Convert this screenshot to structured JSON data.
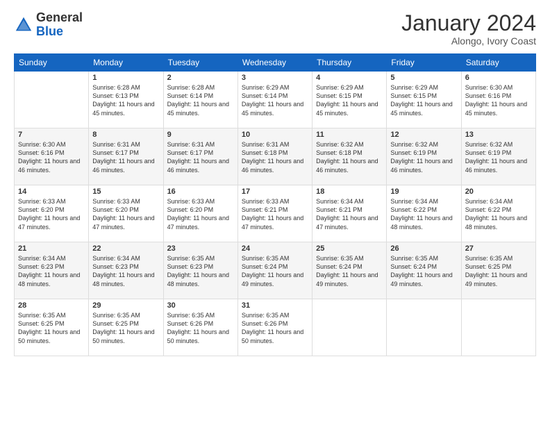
{
  "header": {
    "logo_general": "General",
    "logo_blue": "Blue",
    "month_title": "January 2024",
    "location": "Alongo, Ivory Coast"
  },
  "calendar": {
    "days_of_week": [
      "Sunday",
      "Monday",
      "Tuesday",
      "Wednesday",
      "Thursday",
      "Friday",
      "Saturday"
    ],
    "weeks": [
      [
        {
          "day": "",
          "sunrise": "",
          "sunset": "",
          "daylight": ""
        },
        {
          "day": "1",
          "sunrise": "Sunrise: 6:28 AM",
          "sunset": "Sunset: 6:13 PM",
          "daylight": "Daylight: 11 hours and 45 minutes."
        },
        {
          "day": "2",
          "sunrise": "Sunrise: 6:28 AM",
          "sunset": "Sunset: 6:14 PM",
          "daylight": "Daylight: 11 hours and 45 minutes."
        },
        {
          "day": "3",
          "sunrise": "Sunrise: 6:29 AM",
          "sunset": "Sunset: 6:14 PM",
          "daylight": "Daylight: 11 hours and 45 minutes."
        },
        {
          "day": "4",
          "sunrise": "Sunrise: 6:29 AM",
          "sunset": "Sunset: 6:15 PM",
          "daylight": "Daylight: 11 hours and 45 minutes."
        },
        {
          "day": "5",
          "sunrise": "Sunrise: 6:29 AM",
          "sunset": "Sunset: 6:15 PM",
          "daylight": "Daylight: 11 hours and 45 minutes."
        },
        {
          "day": "6",
          "sunrise": "Sunrise: 6:30 AM",
          "sunset": "Sunset: 6:16 PM",
          "daylight": "Daylight: 11 hours and 45 minutes."
        }
      ],
      [
        {
          "day": "7",
          "sunrise": "Sunrise: 6:30 AM",
          "sunset": "Sunset: 6:16 PM",
          "daylight": "Daylight: 11 hours and 46 minutes."
        },
        {
          "day": "8",
          "sunrise": "Sunrise: 6:31 AM",
          "sunset": "Sunset: 6:17 PM",
          "daylight": "Daylight: 11 hours and 46 minutes."
        },
        {
          "day": "9",
          "sunrise": "Sunrise: 6:31 AM",
          "sunset": "Sunset: 6:17 PM",
          "daylight": "Daylight: 11 hours and 46 minutes."
        },
        {
          "day": "10",
          "sunrise": "Sunrise: 6:31 AM",
          "sunset": "Sunset: 6:18 PM",
          "daylight": "Daylight: 11 hours and 46 minutes."
        },
        {
          "day": "11",
          "sunrise": "Sunrise: 6:32 AM",
          "sunset": "Sunset: 6:18 PM",
          "daylight": "Daylight: 11 hours and 46 minutes."
        },
        {
          "day": "12",
          "sunrise": "Sunrise: 6:32 AM",
          "sunset": "Sunset: 6:19 PM",
          "daylight": "Daylight: 11 hours and 46 minutes."
        },
        {
          "day": "13",
          "sunrise": "Sunrise: 6:32 AM",
          "sunset": "Sunset: 6:19 PM",
          "daylight": "Daylight: 11 hours and 46 minutes."
        }
      ],
      [
        {
          "day": "14",
          "sunrise": "Sunrise: 6:33 AM",
          "sunset": "Sunset: 6:20 PM",
          "daylight": "Daylight: 11 hours and 47 minutes."
        },
        {
          "day": "15",
          "sunrise": "Sunrise: 6:33 AM",
          "sunset": "Sunset: 6:20 PM",
          "daylight": "Daylight: 11 hours and 47 minutes."
        },
        {
          "day": "16",
          "sunrise": "Sunrise: 6:33 AM",
          "sunset": "Sunset: 6:20 PM",
          "daylight": "Daylight: 11 hours and 47 minutes."
        },
        {
          "day": "17",
          "sunrise": "Sunrise: 6:33 AM",
          "sunset": "Sunset: 6:21 PM",
          "daylight": "Daylight: 11 hours and 47 minutes."
        },
        {
          "day": "18",
          "sunrise": "Sunrise: 6:34 AM",
          "sunset": "Sunset: 6:21 PM",
          "daylight": "Daylight: 11 hours and 47 minutes."
        },
        {
          "day": "19",
          "sunrise": "Sunrise: 6:34 AM",
          "sunset": "Sunset: 6:22 PM",
          "daylight": "Daylight: 11 hours and 48 minutes."
        },
        {
          "day": "20",
          "sunrise": "Sunrise: 6:34 AM",
          "sunset": "Sunset: 6:22 PM",
          "daylight": "Daylight: 11 hours and 48 minutes."
        }
      ],
      [
        {
          "day": "21",
          "sunrise": "Sunrise: 6:34 AM",
          "sunset": "Sunset: 6:23 PM",
          "daylight": "Daylight: 11 hours and 48 minutes."
        },
        {
          "day": "22",
          "sunrise": "Sunrise: 6:34 AM",
          "sunset": "Sunset: 6:23 PM",
          "daylight": "Daylight: 11 hours and 48 minutes."
        },
        {
          "day": "23",
          "sunrise": "Sunrise: 6:35 AM",
          "sunset": "Sunset: 6:23 PM",
          "daylight": "Daylight: 11 hours and 48 minutes."
        },
        {
          "day": "24",
          "sunrise": "Sunrise: 6:35 AM",
          "sunset": "Sunset: 6:24 PM",
          "daylight": "Daylight: 11 hours and 49 minutes."
        },
        {
          "day": "25",
          "sunrise": "Sunrise: 6:35 AM",
          "sunset": "Sunset: 6:24 PM",
          "daylight": "Daylight: 11 hours and 49 minutes."
        },
        {
          "day": "26",
          "sunrise": "Sunrise: 6:35 AM",
          "sunset": "Sunset: 6:24 PM",
          "daylight": "Daylight: 11 hours and 49 minutes."
        },
        {
          "day": "27",
          "sunrise": "Sunrise: 6:35 AM",
          "sunset": "Sunset: 6:25 PM",
          "daylight": "Daylight: 11 hours and 49 minutes."
        }
      ],
      [
        {
          "day": "28",
          "sunrise": "Sunrise: 6:35 AM",
          "sunset": "Sunset: 6:25 PM",
          "daylight": "Daylight: 11 hours and 50 minutes."
        },
        {
          "day": "29",
          "sunrise": "Sunrise: 6:35 AM",
          "sunset": "Sunset: 6:25 PM",
          "daylight": "Daylight: 11 hours and 50 minutes."
        },
        {
          "day": "30",
          "sunrise": "Sunrise: 6:35 AM",
          "sunset": "Sunset: 6:26 PM",
          "daylight": "Daylight: 11 hours and 50 minutes."
        },
        {
          "day": "31",
          "sunrise": "Sunrise: 6:35 AM",
          "sunset": "Sunset: 6:26 PM",
          "daylight": "Daylight: 11 hours and 50 minutes."
        },
        {
          "day": "",
          "sunrise": "",
          "sunset": "",
          "daylight": ""
        },
        {
          "day": "",
          "sunrise": "",
          "sunset": "",
          "daylight": ""
        },
        {
          "day": "",
          "sunrise": "",
          "sunset": "",
          "daylight": ""
        }
      ]
    ]
  }
}
